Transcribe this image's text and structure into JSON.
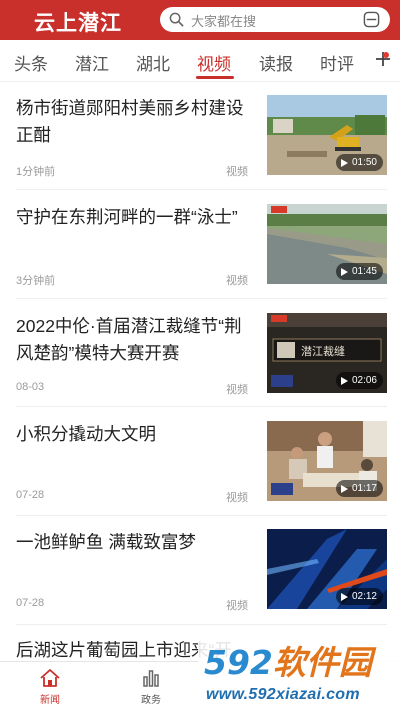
{
  "header": {
    "logo": "云上潜江",
    "search_placeholder": "大家都在搜",
    "brand_color": "#c9302c"
  },
  "tabs": [
    {
      "label": "头条"
    },
    {
      "label": "潜江"
    },
    {
      "label": "湖北"
    },
    {
      "label": "视频",
      "active": true
    },
    {
      "label": "读报"
    },
    {
      "label": "时评"
    }
  ],
  "feed": [
    {
      "title": "杨市街道郧阳村美丽乡村建设正酣",
      "time": "1分钟前",
      "type": "视频",
      "duration": "01:50"
    },
    {
      "title": "守护在东荆河畔的一群“泳士”",
      "time": "3分钟前",
      "type": "视频",
      "duration": "01:45"
    },
    {
      "title": "2022中伦·首届潜江裁缝节“荆风楚韵”模特大赛开赛",
      "time": "08-03",
      "type": "视频",
      "duration": "02:06",
      "overlay_text": "潜江裁缝"
    },
    {
      "title": "小积分撬动大文明",
      "time": "07-28",
      "type": "视频",
      "duration": "01:17"
    },
    {
      "title": "一池鲜鲈鱼 满载致富梦",
      "time": "07-28",
      "type": "视频",
      "duration": "02:12"
    },
    {
      "title": "后湖这片葡萄园上市迎来“开",
      "time": "",
      "type": "",
      "duration": ""
    }
  ],
  "bottom_nav": [
    {
      "label": "新闻",
      "icon": "home-icon",
      "active": true
    },
    {
      "label": "政务",
      "icon": "bar-chart-icon"
    }
  ],
  "watermark": {
    "logo_num": "592",
    "logo_text": "软件园",
    "url": "www.592xiazai.com"
  }
}
